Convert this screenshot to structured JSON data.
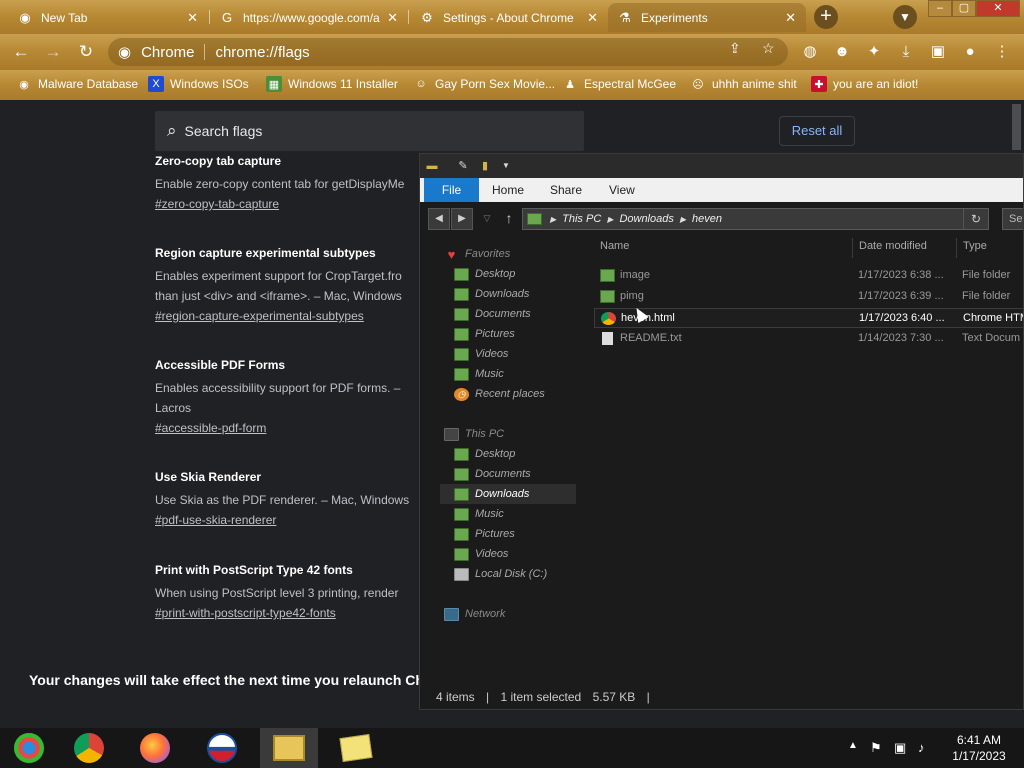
{
  "tabs": [
    {
      "title": "New Tab",
      "icon": "chrome-icon"
    },
    {
      "title": "https://www.google.com/a",
      "icon": "google-icon"
    },
    {
      "title": "Settings - About Chrome",
      "icon": "gear-icon"
    },
    {
      "title": "Experiments",
      "icon": "flask-icon"
    }
  ],
  "omnibox": {
    "chip": "Chrome",
    "url": "chrome://flags"
  },
  "bookmarks": [
    "Malware Database",
    "Windows ISOs",
    "Windows 11 Installer",
    "Gay Porn Sex Movie...",
    "Espectral McGee",
    "uhhh anime shit",
    "you are an idiot!"
  ],
  "flags_page": {
    "search_placeholder": "Search flags",
    "reset_label": "Reset all",
    "flags": [
      {
        "title": "Zero-copy tab capture",
        "desc": [
          "Enable zero-copy content tab for getDisplayMe"
        ],
        "link": "#zero-copy-tab-capture"
      },
      {
        "title": "Region capture experimental subtypes",
        "desc": [
          "Enables experiment support for CropTarget.fro",
          "than just <div> and <iframe>. – Mac, Windows"
        ],
        "link": "#region-capture-experimental-subtypes"
      },
      {
        "title": "Accessible PDF Forms",
        "desc": [
          "Enables accessibility support for PDF forms. –",
          "Lacros"
        ],
        "link": "#accessible-pdf-form"
      },
      {
        "title": "Use Skia Renderer",
        "desc": [
          "Use Skia as the PDF renderer. – Mac, Windows"
        ],
        "link": "#pdf-use-skia-renderer"
      },
      {
        "title": "Print with PostScript Type 42 fonts",
        "desc": [
          "When using PostScript level 3 printing, render"
        ],
        "link": "#print-with-postscript-type42-fonts"
      }
    ],
    "relaunch_text": "Your changes will take effect the next time you relaunch Ch"
  },
  "explorer": {
    "ribbon_tabs": [
      "File",
      "Home",
      "Share",
      "View"
    ],
    "path": [
      "This PC",
      "Downloads",
      "heven"
    ],
    "search_placeholder": "Sea",
    "nav": {
      "favorites_label": "Favorites",
      "favorites": [
        "Desktop",
        "Downloads",
        "Documents",
        "Pictures",
        "Videos",
        "Music",
        "Recent places"
      ],
      "thispc_label": "This PC",
      "thispc": [
        "Desktop",
        "Documents",
        "Downloads",
        "Music",
        "Pictures",
        "Videos",
        "Local Disk (C:)"
      ],
      "network_label": "Network"
    },
    "columns": [
      "Name",
      "Date modified",
      "Type"
    ],
    "files": [
      {
        "name": "image",
        "date": "1/17/2023 6:38 ...",
        "type": "File folder",
        "kind": "folder"
      },
      {
        "name": "pimg",
        "date": "1/17/2023 6:39 ...",
        "type": "File folder",
        "kind": "folder"
      },
      {
        "name": "heven.html",
        "date": "1/17/2023 6:40 ...",
        "type": "Chrome HTM",
        "kind": "chrome"
      },
      {
        "name": "README.txt",
        "date": "1/14/2023 7:30 ...",
        "type": "Text Docum",
        "kind": "text"
      }
    ],
    "status": {
      "items": "4 items",
      "selected": "1 item selected",
      "size": "5.57 KB"
    }
  },
  "taskbar": {
    "time": "6:41 AM",
    "date": "1/17/2023"
  }
}
